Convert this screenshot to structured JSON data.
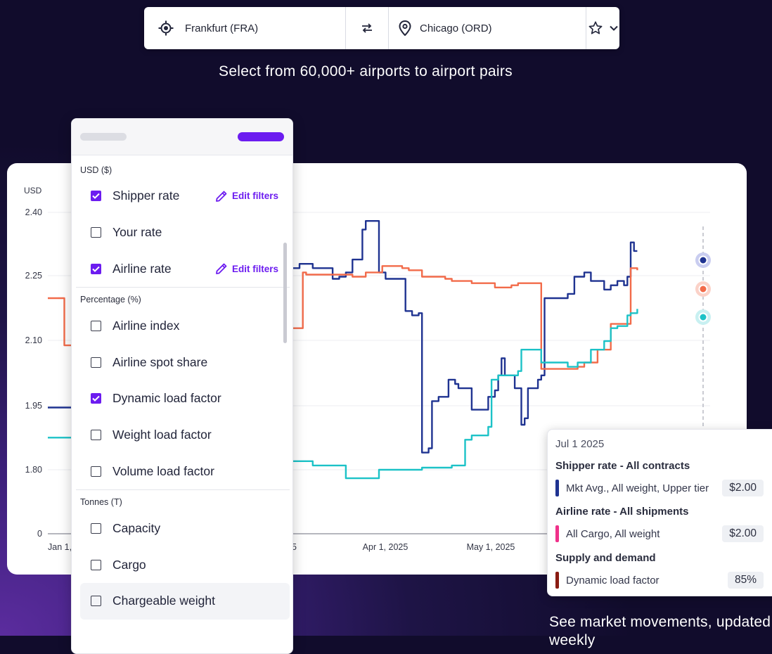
{
  "route": {
    "origin": "Frankfurt (FRA)",
    "destination": "Chicago (ORD)",
    "origin_icon": "location-target-icon",
    "swap_icon": "swap-arrows-icon",
    "destination_icon": "map-pin-icon",
    "favorite_icon": "star-icon",
    "dropdown_icon": "chevron-down-icon"
  },
  "tagline": "Select from 60,000+ airports to airport pairs",
  "tagline2": "See market movements, updated weekly",
  "colors": {
    "accent": "#6c1cf0",
    "shipper_rate": "#1f3391",
    "airline_rate": "#f26b4a",
    "dynamic_load_factor": "#1cc2c7",
    "tt_shipper": "#1f3391",
    "tt_airline": "#f0318a",
    "tt_supply": "#8a1c12"
  },
  "panel": {
    "sections": [
      {
        "label": "USD ($)",
        "options": [
          {
            "label": "Shipper rate",
            "checked": true,
            "edit": "Edit filters"
          },
          {
            "label": "Your rate",
            "checked": false
          },
          {
            "label": "Airline rate",
            "checked": true,
            "edit": "Edit filters"
          }
        ]
      },
      {
        "label": "Percentage (%)",
        "options": [
          {
            "label": "Airline index",
            "checked": false
          },
          {
            "label": "Airline spot share",
            "checked": false
          },
          {
            "label": "Dynamic load factor",
            "checked": true
          },
          {
            "label": "Weight load factor",
            "checked": false
          },
          {
            "label": "Volume load factor",
            "checked": false
          }
        ]
      },
      {
        "label": "Tonnes (T)",
        "options": [
          {
            "label": "Capacity",
            "checked": false
          },
          {
            "label": "Cargo",
            "checked": false
          },
          {
            "label": "Chargeable weight",
            "checked": false
          }
        ]
      }
    ]
  },
  "tooltip": {
    "date": "Jul 1 2025",
    "groups": [
      {
        "title": "Shipper rate - All contracts",
        "row": {
          "label": "Mkt Avg., All weight, Upper tier",
          "value": "$2.00"
        }
      },
      {
        "title": "Airline rate - All shipments",
        "row": {
          "label": "All Cargo, All weight",
          "value": "$2.00"
        }
      },
      {
        "title": "Supply and demand",
        "row": {
          "label": "Dynamic load factor",
          "value": "85%"
        }
      }
    ]
  },
  "chart_data": {
    "type": "line",
    "ylabel": "USD",
    "y_ticks": [
      "0",
      "1.80",
      "1.95",
      "2.10",
      "2.25",
      "2.40"
    ],
    "x_ticks": [
      "Jan 1,",
      "2025",
      "Apr 1, 2025",
      "May 1, 2025"
    ],
    "grid": true,
    "series": [
      {
        "name": "Shipper rate",
        "color": "#1f3391",
        "points": [
          [
            0,
            1.945
          ],
          [
            0.05,
            1.945
          ],
          [
            0.06,
            1.94
          ],
          [
            0.085,
            1.94
          ],
          [
            0.09,
            2.25
          ],
          [
            0.14,
            2.27
          ],
          [
            0.16,
            2.26
          ],
          [
            0.19,
            2.28
          ],
          [
            0.22,
            2.245
          ],
          [
            0.245,
            2.22
          ],
          [
            0.26,
            2.22
          ],
          [
            0.265,
            2.245
          ],
          [
            0.28,
            2.25
          ],
          [
            0.3,
            2.25
          ],
          [
            0.33,
            2.285
          ],
          [
            0.34,
            2.365
          ],
          [
            0.345,
            2.29
          ],
          [
            0.36,
            2.22
          ],
          [
            0.365,
            2.27
          ],
          [
            0.38,
            2.28
          ],
          [
            0.4,
            2.27
          ],
          [
            0.43,
            2.245
          ],
          [
            0.44,
            2.25
          ],
          [
            0.45,
            2.26
          ],
          [
            0.46,
            2.29
          ],
          [
            0.475,
            2.36
          ],
          [
            0.48,
            2.38
          ],
          [
            0.495,
            2.38
          ],
          [
            0.5,
            2.26
          ],
          [
            0.51,
            2.245
          ],
          [
            0.535,
            2.245
          ],
          [
            0.54,
            2.17
          ],
          [
            0.55,
            2.16
          ],
          [
            0.56,
            2.165
          ],
          [
            0.565,
            1.84
          ],
          [
            0.575,
            1.85
          ],
          [
            0.58,
            1.96
          ],
          [
            0.59,
            1.97
          ],
          [
            0.6,
            1.97
          ],
          [
            0.605,
            2.01
          ],
          [
            0.615,
            2.0
          ],
          [
            0.62,
            1.99
          ],
          [
            0.63,
            1.99
          ],
          [
            0.64,
            1.94
          ],
          [
            0.66,
            1.94
          ],
          [
            0.665,
            1.97
          ],
          [
            0.675,
            1.985
          ],
          [
            0.68,
            2.02
          ],
          [
            0.685,
            2.06
          ],
          [
            0.69,
            2.02
          ],
          [
            0.7,
            2.02
          ],
          [
            0.705,
            1.99
          ],
          [
            0.71,
            1.99
          ],
          [
            0.715,
            1.905
          ],
          [
            0.72,
            1.92
          ],
          [
            0.725,
            1.99
          ],
          [
            0.735,
            1.99
          ],
          [
            0.74,
            2.01
          ],
          [
            0.745,
            2.02
          ],
          [
            0.75,
            2.2
          ],
          [
            0.76,
            2.2
          ],
          [
            0.765,
            2.2
          ],
          [
            0.775,
            2.2
          ],
          [
            0.785,
            2.21
          ],
          [
            0.795,
            2.25
          ],
          [
            0.81,
            2.26
          ],
          [
            0.82,
            2.24
          ],
          [
            0.83,
            2.24
          ],
          [
            0.84,
            2.22
          ],
          [
            0.85,
            2.23
          ],
          [
            0.86,
            2.24
          ],
          [
            0.87,
            2.23
          ],
          [
            0.875,
            2.25
          ],
          [
            0.88,
            2.33
          ],
          [
            0.885,
            2.31
          ],
          [
            0.89,
            2.31
          ]
        ]
      },
      {
        "name": "Airline rate",
        "color": "#f26b4a",
        "points": [
          [
            0,
            2.2
          ],
          [
            0.02,
            2.2
          ],
          [
            0.025,
            2.09
          ],
          [
            0.085,
            2.09
          ],
          [
            0.09,
            2.14
          ],
          [
            0.12,
            2.14
          ],
          [
            0.13,
            2.145
          ],
          [
            0.16,
            2.14
          ],
          [
            0.2,
            2.14
          ],
          [
            0.22,
            2.145
          ],
          [
            0.24,
            2.14
          ],
          [
            0.27,
            2.135
          ],
          [
            0.29,
            2.14
          ],
          [
            0.31,
            2.135
          ],
          [
            0.33,
            2.14
          ],
          [
            0.345,
            2.14
          ],
          [
            0.35,
            2.13
          ],
          [
            0.38,
            2.13
          ],
          [
            0.385,
            2.26
          ],
          [
            0.39,
            2.255
          ],
          [
            0.44,
            2.255
          ],
          [
            0.46,
            2.25
          ],
          [
            0.47,
            2.25
          ],
          [
            0.48,
            2.26
          ],
          [
            0.5,
            2.26
          ],
          [
            0.505,
            2.275
          ],
          [
            0.53,
            2.275
          ],
          [
            0.535,
            2.27
          ],
          [
            0.545,
            2.265
          ],
          [
            0.56,
            2.265
          ],
          [
            0.565,
            2.25
          ],
          [
            0.58,
            2.25
          ],
          [
            0.6,
            2.245
          ],
          [
            0.61,
            2.24
          ],
          [
            0.625,
            2.24
          ],
          [
            0.64,
            2.235
          ],
          [
            0.66,
            2.235
          ],
          [
            0.675,
            2.225
          ],
          [
            0.7,
            2.23
          ],
          [
            0.71,
            2.235
          ],
          [
            0.74,
            2.235
          ],
          [
            0.745,
            2.035
          ],
          [
            0.76,
            2.035
          ],
          [
            0.8,
            2.04
          ],
          [
            0.81,
            2.05
          ],
          [
            0.82,
            2.05
          ],
          [
            0.83,
            2.08
          ],
          [
            0.84,
            2.08
          ],
          [
            0.85,
            2.14
          ],
          [
            0.875,
            2.14
          ],
          [
            0.88,
            2.27
          ],
          [
            0.89,
            2.265
          ]
        ]
      },
      {
        "name": "Dynamic load factor",
        "color": "#1cc2c7",
        "points": [
          [
            0,
            1.875
          ],
          [
            0.09,
            1.875
          ],
          [
            0.095,
            1.83
          ],
          [
            0.3,
            1.83
          ],
          [
            0.34,
            1.82
          ],
          [
            0.38,
            1.82
          ],
          [
            0.4,
            1.81
          ],
          [
            0.44,
            1.81
          ],
          [
            0.45,
            1.78
          ],
          [
            0.49,
            1.78
          ],
          [
            0.5,
            1.8
          ],
          [
            0.56,
            1.8
          ],
          [
            0.565,
            1.805
          ],
          [
            0.6,
            1.805
          ],
          [
            0.61,
            1.81
          ],
          [
            0.62,
            1.81
          ],
          [
            0.63,
            1.87
          ],
          [
            0.64,
            1.88
          ],
          [
            0.66,
            1.88
          ],
          [
            0.665,
            1.9
          ],
          [
            0.67,
            2.01
          ],
          [
            0.68,
            2.02
          ],
          [
            0.71,
            2.03
          ],
          [
            0.715,
            2.08
          ],
          [
            0.74,
            2.08
          ],
          [
            0.745,
            2.05
          ],
          [
            0.76,
            2.05
          ],
          [
            0.77,
            2.05
          ],
          [
            0.78,
            2.05
          ],
          [
            0.785,
            2.04
          ],
          [
            0.8,
            2.05
          ],
          [
            0.81,
            2.05
          ],
          [
            0.82,
            2.08
          ],
          [
            0.84,
            2.1
          ],
          [
            0.85,
            2.13
          ],
          [
            0.86,
            2.135
          ],
          [
            0.875,
            2.16
          ],
          [
            0.88,
            2.165
          ],
          [
            0.89,
            2.175
          ]
        ]
      }
    ]
  }
}
